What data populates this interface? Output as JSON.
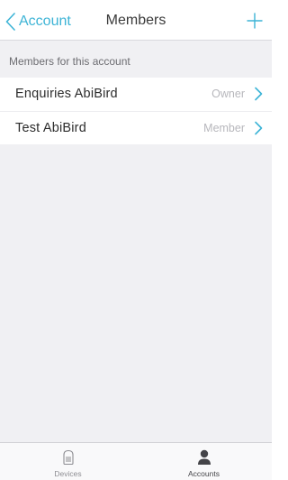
{
  "colors": {
    "accent": "#3db4d6",
    "background": "#f0f0f3",
    "secondary_text": "#b7b7bc"
  },
  "navbar": {
    "back_label": "Account",
    "back_icon": "chevron-left-icon",
    "title": "Members",
    "add_icon": "plus-icon"
  },
  "section": {
    "header": "Members for this account"
  },
  "members": [
    {
      "name": "Enquiries AbiBird",
      "role": "Owner"
    },
    {
      "name": "Test AbiBird",
      "role": "Member"
    }
  ],
  "tabbar": {
    "tabs": [
      {
        "label": "Devices",
        "icon": "device-icon",
        "selected": false
      },
      {
        "label": "Accounts",
        "icon": "person-icon",
        "selected": true
      }
    ]
  }
}
